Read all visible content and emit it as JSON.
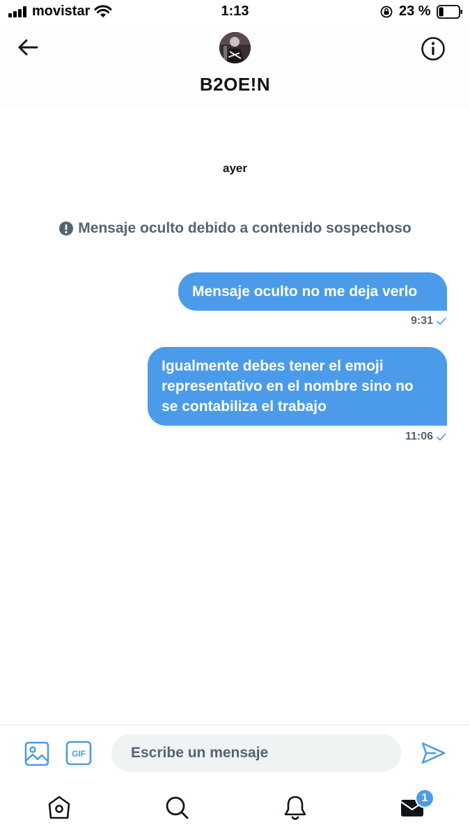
{
  "status_bar": {
    "carrier": "movistar",
    "time": "1:13",
    "battery_percent": "23 %",
    "battery_level": 0.23
  },
  "header": {
    "contact_name": "B2OE!N",
    "back_icon": "arrow-left-icon",
    "info_icon": "info-circle-icon"
  },
  "conversation": {
    "date_separator": "ayer",
    "hidden_notice": "Mensaje oculto debido a contenido sospechoso",
    "messages": [
      {
        "text": "Mensaje oculto no me deja verlo",
        "time": "9:31",
        "sent": true
      },
      {
        "text": "Igualmente debes tener el emoji representativo en el nombre sino no se contabiliza el trabajo",
        "time": "11:06",
        "sent": true
      }
    ]
  },
  "composer": {
    "placeholder": "Escribe un mensaje",
    "gif_label": "GIF"
  },
  "tabbar": {
    "messages_badge": "1"
  },
  "colors": {
    "accent": "#4c9bea",
    "secondary_text": "#536471",
    "primary_text": "#0f1419"
  }
}
